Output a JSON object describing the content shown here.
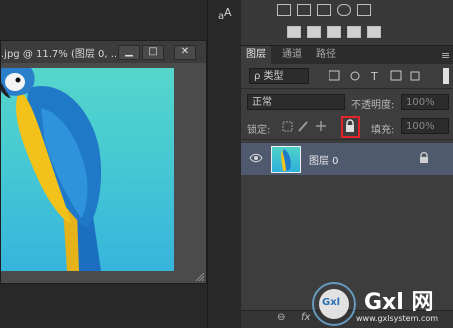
{
  "document": {
    "title": ".jpg @ 11.7% (图层 0, ...",
    "minimize": "▁",
    "maximize": "□",
    "close": "✕"
  },
  "panels": {
    "tabs": [
      "图层",
      "通道",
      "路径"
    ],
    "filter_label": "ρ 类型",
    "blend_mode": "正常",
    "opacity_label": "不透明度:",
    "opacity_value": "100%",
    "lock_label": "锁定:",
    "fill_label": "填充:",
    "fill_value": "100%",
    "layer_name": "图层 0",
    "menu_icon": "≡"
  },
  "bottom_bar": {
    "link_glyph": "⊖",
    "fx_label": "fx"
  },
  "watermark": {
    "logo": "Gxl",
    "brand": "Gxl 网",
    "url": "www.gxlsystem.com"
  },
  "colors": {
    "highlight": "#e4232b",
    "selected_layer": "#505a6e",
    "photo_top": "#56d6cb",
    "photo_bottom": "#37b4dd"
  }
}
